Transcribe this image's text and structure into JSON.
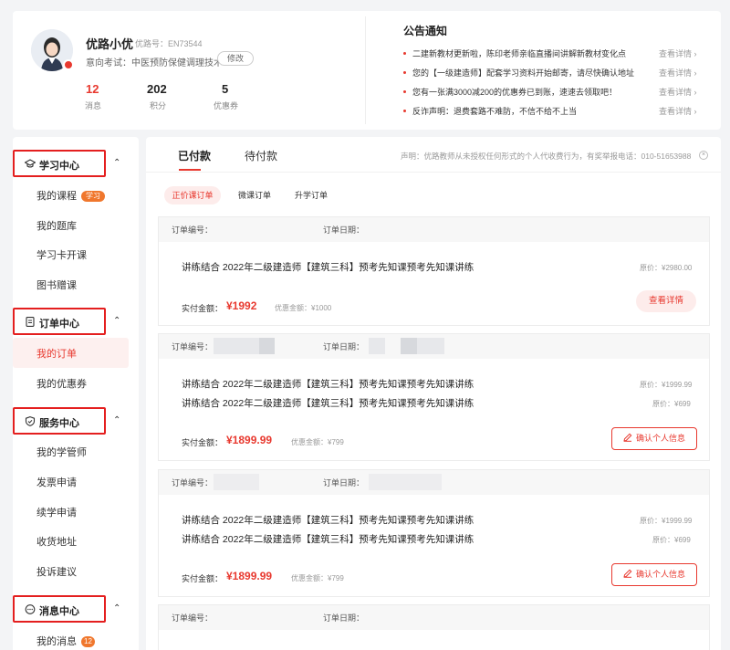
{
  "profile": {
    "name": "优路小优",
    "user_id": "优路号：EN73544",
    "intent": "意向考试：中医预防保健调理技术",
    "edit_label": "修改",
    "stats": [
      {
        "value": "12",
        "label": "消息",
        "color": "#e8392f"
      },
      {
        "value": "202",
        "label": "积分"
      },
      {
        "value": "5",
        "label": "优惠券"
      }
    ]
  },
  "notices": {
    "title": "公告通知",
    "items": [
      {
        "text": "二建新教材更新啦，陈印老师亲临直播间讲解新教材变化点",
        "more": "查看详情 ›"
      },
      {
        "text": "您的【一级建造师】配套学习资料开始邮寄，请尽快确认地址",
        "more": "查看详情 ›"
      },
      {
        "text": "您有一张满3000减200的优惠券已到账，速速去领取吧！",
        "more": "查看详情 ›"
      },
      {
        "text": "反诈声明：退费套路不难防，不信不给不上当",
        "more": "查看详情 ›"
      }
    ]
  },
  "sidebar": {
    "sections": [
      {
        "label": "学习中心",
        "icon": "graduation-cap-icon",
        "items": [
          {
            "label": "我的课程",
            "badge": "学习"
          },
          {
            "label": "我的题库"
          },
          {
            "label": "学习卡开课"
          },
          {
            "label": "图书赠课"
          }
        ]
      },
      {
        "label": "订单中心",
        "icon": "document-icon",
        "items": [
          {
            "label": "我的订单",
            "active": true
          },
          {
            "label": "我的优惠券"
          }
        ]
      },
      {
        "label": "服务中心",
        "icon": "shield-icon",
        "items": [
          {
            "label": "我的学管师"
          },
          {
            "label": "发票申请"
          },
          {
            "label": "续学申请"
          },
          {
            "label": "收货地址"
          },
          {
            "label": "投诉建议"
          }
        ]
      },
      {
        "label": "消息中心",
        "icon": "chat-icon",
        "items": [
          {
            "label": "我的消息",
            "badge": "12"
          }
        ]
      }
    ],
    "caret": "⌃"
  },
  "tabs": [
    {
      "label": "已付款",
      "active": true
    },
    {
      "label": "待付款"
    }
  ],
  "statement": "声明：优路教师从未授权任何形式的个人代收费行为，有奖举报电话：010-51653988",
  "close_symbol": "×",
  "subtabs": [
    {
      "label": "正价课订单",
      "active": true
    },
    {
      "label": "微课订单"
    },
    {
      "label": "升学订单"
    }
  ],
  "orders": {
    "order_no_label": "订单编号：",
    "order_date_label": "订单日期：",
    "pay_label": "实付金额：",
    "list": [
      {
        "courses": [
          {
            "title": "讲练结合 2022年二级建造师【建筑三科】预考先知课预考先知课讲练",
            "price": "原价：¥2980.00"
          }
        ],
        "amount": "¥1992",
        "discount": "优惠金额：¥1000",
        "action": "查看详情"
      },
      {
        "courses": [
          {
            "title": "讲练结合 2022年二级建造师【建筑三科】预考先知课预考先知课讲练",
            "price": "原价：¥1999.99"
          },
          {
            "title": "讲练结合 2022年二级建造师【建筑三科】预考先知课预考先知课讲练",
            "price": "原价：¥699"
          }
        ],
        "amount": "¥1899.99",
        "discount": "优惠金额：¥799",
        "action": "确认个人信息"
      },
      {
        "courses": [
          {
            "title": "讲练结合 2022年二级建造师【建筑三科】预考先知课预考先知课讲练",
            "price": "原价：¥1999.99"
          },
          {
            "title": "讲练结合 2022年二级建造师【建筑三科】预考先知课预考先知课讲练",
            "price": "原价：¥699"
          }
        ],
        "amount": "¥1899.99",
        "discount": "优惠金额：¥799",
        "action": "确认个人信息"
      }
    ]
  },
  "colors": {
    "accent": "#e8392f",
    "highlight_box": "#e41f1f",
    "badge": "#f0772d"
  }
}
